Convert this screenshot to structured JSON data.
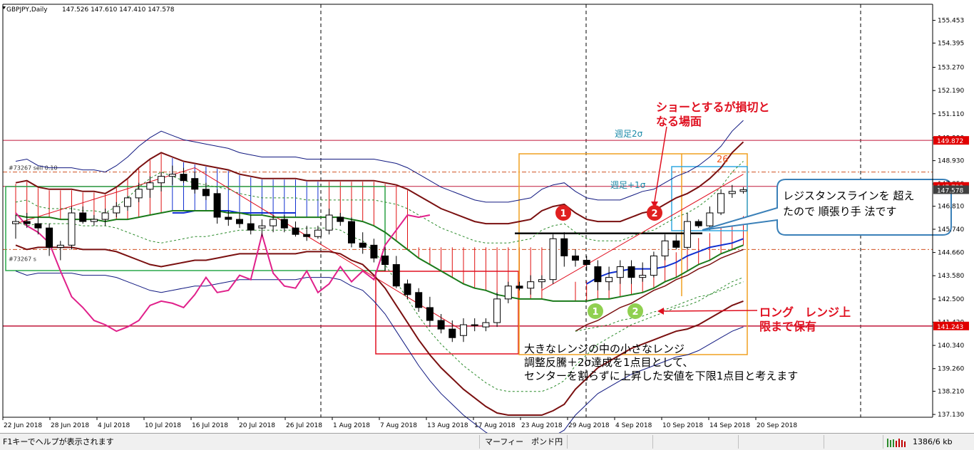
{
  "header": {
    "symbol_label": "GBPJPY,Daily",
    "ohlc": "147.526 147.610 147.410 147.578"
  },
  "chart_data": {
    "type": "candlestick",
    "symbol": "GBPJPY",
    "timeframe": "Daily",
    "ylim": [
      137.0,
      156.2
    ],
    "y_ticks": [
      "155.453",
      "154.395",
      "153.270",
      "152.190",
      "151.110",
      "149.990",
      "148.930",
      "147.850",
      "146.810",
      "145.740",
      "144.660",
      "143.580",
      "142.500",
      "141.420",
      "140.340",
      "139.260",
      "138.210",
      "137.130"
    ],
    "price_tags": [
      {
        "label": "149.872",
        "value": 149.872,
        "color": "#e00000"
      },
      {
        "label": "147.733",
        "value": 147.733,
        "color": "#e00000"
      },
      {
        "label": "147.578",
        "value": 147.578,
        "color": "#404040"
      },
      {
        "label": "141.243",
        "value": 141.243,
        "color": "#e00000"
      }
    ],
    "x_labels": [
      "22 Jun 2018",
      "28 Jun 2018",
      "4 Jul 2018",
      "10 Jul 2018",
      "16 Jul 2018",
      "20 Jul 2018",
      "26 Jul 2018",
      "1 Aug 2018",
      "7 Aug 2018",
      "13 Aug 2018",
      "17 Aug 2018",
      "23 Aug 2018",
      "29 Aug 2018",
      "4 Sep 2018",
      "10 Sep 2018",
      "14 Sep 2018",
      "20 Sep 2018"
    ],
    "candles": [
      [
        146.0,
        146.4,
        145.3,
        146.1
      ],
      [
        146.1,
        146.5,
        145.8,
        146.0
      ],
      [
        146.0,
        146.3,
        145.5,
        145.8
      ],
      [
        145.8,
        146.0,
        144.5,
        144.9
      ],
      [
        144.9,
        145.2,
        144.3,
        145.0
      ],
      [
        145.0,
        146.8,
        144.8,
        146.5
      ],
      [
        146.5,
        146.8,
        146.0,
        146.1
      ],
      [
        146.1,
        146.4,
        145.9,
        146.2
      ],
      [
        146.2,
        146.7,
        145.9,
        146.5
      ],
      [
        146.5,
        147.0,
        146.3,
        146.8
      ],
      [
        146.8,
        147.3,
        146.6,
        147.2
      ],
      [
        147.2,
        147.9,
        147.0,
        147.6
      ],
      [
        147.6,
        148.2,
        147.2,
        147.9
      ],
      [
        147.9,
        148.4,
        147.5,
        148.2
      ],
      [
        148.2,
        148.7,
        147.8,
        148.3
      ],
      [
        148.3,
        148.6,
        147.9,
        148.0
      ],
      [
        148.1,
        148.4,
        147.4,
        147.6
      ],
      [
        147.6,
        147.9,
        147.1,
        147.3
      ],
      [
        147.4,
        147.6,
        146.0,
        146.3
      ],
      [
        146.3,
        146.6,
        145.9,
        146.2
      ],
      [
        146.2,
        146.5,
        145.8,
        146.0
      ],
      [
        146.0,
        146.4,
        145.5,
        145.7
      ],
      [
        145.8,
        146.2,
        145.4,
        145.9
      ],
      [
        145.9,
        146.4,
        145.6,
        146.2
      ],
      [
        146.2,
        146.4,
        145.6,
        145.8
      ],
      [
        145.8,
        146.1,
        145.4,
        145.5
      ],
      [
        145.5,
        145.9,
        145.2,
        145.4
      ],
      [
        145.4,
        145.9,
        145.3,
        145.7
      ],
      [
        145.7,
        146.7,
        145.5,
        146.4
      ],
      [
        146.3,
        146.5,
        145.9,
        146.1
      ],
      [
        146.1,
        146.3,
        144.9,
        145.1
      ],
      [
        145.1,
        145.6,
        144.6,
        144.9
      ],
      [
        145.0,
        145.3,
        144.2,
        144.4
      ],
      [
        144.5,
        144.9,
        143.8,
        144.1
      ],
      [
        144.1,
        144.5,
        143.0,
        143.1
      ],
      [
        143.2,
        143.4,
        142.5,
        142.7
      ],
      [
        142.8,
        143.0,
        141.9,
        142.1
      ],
      [
        142.1,
        142.6,
        141.2,
        141.5
      ],
      [
        141.5,
        141.8,
        140.9,
        141.1
      ],
      [
        141.1,
        141.5,
        140.5,
        140.7
      ],
      [
        140.8,
        141.6,
        140.5,
        141.3
      ],
      [
        141.3,
        141.6,
        141.0,
        141.3
      ],
      [
        141.2,
        141.6,
        141.0,
        141.4
      ],
      [
        141.4,
        142.8,
        141.2,
        142.5
      ],
      [
        142.5,
        143.3,
        142.3,
        143.1
      ],
      [
        143.1,
        143.3,
        142.9,
        143.0
      ],
      [
        143.0,
        143.6,
        142.7,
        143.3
      ],
      [
        143.3,
        143.6,
        143.0,
        143.4
      ],
      [
        143.4,
        145.5,
        143.2,
        145.3
      ],
      [
        145.3,
        145.6,
        144.0,
        144.5
      ],
      [
        144.5,
        144.8,
        144.0,
        144.3
      ],
      [
        144.3,
        144.5,
        143.8,
        144.1
      ],
      [
        144.0,
        144.3,
        142.9,
        143.3
      ],
      [
        143.3,
        144.0,
        142.9,
        143.5
      ],
      [
        143.5,
        144.3,
        143.2,
        144.0
      ],
      [
        144.0,
        144.3,
        143.2,
        143.5
      ],
      [
        143.5,
        144.2,
        143.3,
        143.6
      ],
      [
        143.6,
        144.7,
        143.5,
        144.5
      ],
      [
        144.5,
        145.5,
        144.3,
        145.2
      ],
      [
        145.2,
        145.5,
        144.8,
        144.9
      ],
      [
        144.9,
        146.5,
        144.8,
        146.1
      ],
      [
        146.1,
        146.2,
        145.8,
        145.9
      ],
      [
        145.9,
        146.8,
        145.7,
        146.5
      ],
      [
        146.5,
        147.6,
        146.4,
        147.4
      ],
      [
        147.4,
        147.8,
        147.2,
        147.5
      ],
      [
        147.5,
        147.7,
        147.4,
        147.58
      ]
    ],
    "upper_band": [
      147.9,
      148.0,
      147.7,
      147.6,
      147.6,
      147.6,
      147.5,
      147.5,
      147.4,
      147.7,
      148.1,
      148.6,
      149.0,
      149.3,
      149.1,
      148.9,
      148.8,
      148.7,
      148.6,
      148.5,
      148.3,
      148.2,
      148.1,
      148.1,
      148.1,
      148.1,
      148.0,
      148.0,
      148.0,
      148.0,
      148.0,
      148.0,
      148.0,
      147.9,
      147.8,
      147.6,
      147.3,
      147.0,
      146.7,
      146.5,
      146.3,
      146.1,
      146.0,
      146.0,
      146.0,
      146.1,
      146.2,
      146.6,
      146.8,
      146.9,
      146.5,
      146.2,
      146.1,
      146.1,
      146.1,
      146.3,
      146.5,
      146.6,
      146.9,
      147.2,
      147.4,
      147.7,
      148.1,
      148.6,
      149.3,
      149.8
    ],
    "mid_line": [
      146.4,
      146.3,
      146.3,
      146.3,
      146.2,
      146.2,
      146.2,
      146.2,
      146.1,
      146.2,
      146.2,
      146.3,
      146.4,
      146.5,
      146.6,
      146.6,
      146.6,
      146.6,
      146.6,
      146.5,
      146.5,
      146.4,
      146.4,
      146.3,
      146.3,
      146.3,
      146.3,
      146.3,
      146.3,
      146.3,
      146.2,
      146.1,
      145.9,
      145.6,
      145.2,
      144.8,
      144.4,
      144.1,
      143.8,
      143.5,
      143.2,
      143.0,
      142.9,
      142.7,
      142.6,
      142.5,
      142.5,
      142.5,
      142.4,
      142.4,
      142.4,
      142.4,
      142.5,
      142.5,
      142.6,
      142.7,
      142.8,
      143.0,
      143.3,
      143.5,
      143.8,
      144.1,
      144.3,
      144.6,
      144.8,
      145.0
    ],
    "lower_band": [
      145.0,
      144.8,
      144.9,
      144.9,
      144.9,
      144.9,
      144.8,
      144.8,
      144.8,
      144.7,
      144.5,
      144.3,
      144.1,
      144.0,
      144.1,
      144.2,
      144.3,
      144.3,
      144.4,
      144.5,
      144.6,
      144.6,
      144.6,
      144.6,
      144.6,
      144.6,
      144.7,
      144.7,
      144.7,
      144.6,
      144.3,
      144.1,
      143.6,
      143.0,
      142.2,
      141.4,
      140.6,
      139.9,
      139.3,
      138.8,
      138.3,
      137.9,
      137.5,
      137.2,
      137.1,
      137.1,
      137.1,
      137.1,
      137.3,
      137.6,
      138.3,
      138.8,
      139.3,
      139.6,
      139.9,
      140.2,
      140.4,
      140.6,
      140.8,
      141.0,
      141.1,
      141.3,
      141.6,
      141.9,
      142.2,
      142.4
    ],
    "rsi_like": [
      146.5,
      145.9,
      145.6,
      145.1,
      143.8,
      142.6,
      142.1,
      141.5,
      141.3,
      141.0,
      141.2,
      141.5,
      142.2,
      142.4,
      142.3,
      142.1,
      142.7,
      143.5,
      142.8,
      142.9,
      143.6,
      143.4,
      145.5,
      143.7,
      143.1,
      143.0,
      143.8,
      142.8,
      143.2,
      144.0,
      143.3,
      143.8,
      143.4,
      145.0,
      145.7,
      146.4,
      146.3,
      146.4
    ],
    "weekly_upper": [
      141.0,
      141.3,
      141.5,
      141.8,
      142.1,
      142.3,
      142.6,
      142.9,
      143.1,
      143.4,
      143.6,
      143.9,
      144.1,
      144.4,
      144.6,
      144.8
    ],
    "weekly_lower": [
      141.0,
      141.1,
      141.2,
      141.3,
      141.5,
      141.6,
      141.7,
      141.9,
      142.0,
      142.2,
      142.4,
      142.6,
      142.7,
      142.9,
      143.1,
      143.3
    ],
    "horizontal_lines": [
      149.872,
      147.733,
      141.243
    ],
    "object_labels": [
      "#73267 sell 0.10",
      "#73267 s"
    ]
  },
  "annotations": {
    "short_stop": "ショーとするが損切と\nなる場面",
    "weekly_2sigma": "週足2σ",
    "weekly_1sigma": "週足+1σ",
    "count_26": "26",
    "resistance_callout": "レジスタンスラインを 超え\nたので 順張り手 法です",
    "long_note": "ロング　レンジ上\n限まで保有",
    "big_text": "大きなレンジの中の小さなレンジ\n調整反騰＋2σ達成を1点目として、\nセンターを割らずに上昇した安値を下限1点目と考えます",
    "marker_1": "1",
    "marker_2": "2"
  },
  "status_bar": {
    "help_text": "F1キーでヘルプが表示されます",
    "profile_name": "マーフィー　ポンド円",
    "traffic": "1386/6 kb"
  }
}
